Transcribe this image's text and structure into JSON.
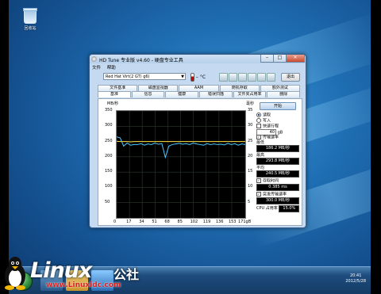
{
  "desktop": {
    "recycle_bin_label": "回收站"
  },
  "window": {
    "title": "HD Tune 专业版 v4.60 - 硬盘专业工具",
    "buttons": {
      "minimize": "–",
      "maximize": "□",
      "close": "✕"
    },
    "menu": [
      "文件",
      "帮助"
    ],
    "toolbar": {
      "drive": "Red Hat Virt(2 GT) g6)",
      "temperature": "– °C",
      "exit_label": "退出"
    },
    "tabs_row1": [
      "文件基准",
      "磁盘监视器",
      "AAM",
      "随机存取",
      "额外测试"
    ],
    "tabs_row2": [
      "基准",
      "信息",
      "健康",
      "错误扫描",
      "文件夹占用率",
      "删除"
    ],
    "active_tab": "基准"
  },
  "benchmark": {
    "unit_left": "MB/秒",
    "unit_right": "毫秒",
    "start_label": "开始",
    "read_label": "读取",
    "write_label": "写入",
    "quick_label": "快速行程",
    "quick_value": "40",
    "quick_unit": "gB",
    "transfer_label": "传输速率",
    "min_label": "最低",
    "min_value": "186.2 MB/秒",
    "max_label": "最高",
    "max_value": "293.8 MB/秒",
    "avg_label": "平均",
    "avg_value": "240.5 MB/秒",
    "access_label": "存取时间",
    "access_value": "0.385 ms",
    "burst_label": "突发传输速率",
    "burst_value": "300.0 MB/秒",
    "cpu_label": "CPU 占用率",
    "cpu_value": "15.0%"
  },
  "chart_data": {
    "type": "line",
    "title": "",
    "xlabel": "",
    "ylabel": "MB/秒",
    "y2label": "毫秒",
    "x": [
      0,
      17,
      34,
      51,
      68,
      85,
      102,
      119,
      136,
      153,
      171
    ],
    "x_tick_labels": [
      "0",
      "17",
      "34",
      "51",
      "68",
      "85",
      "102",
      "119",
      "136",
      "153",
      "171gB"
    ],
    "y_ticks": [
      50,
      100,
      150,
      200,
      250,
      300,
      350
    ],
    "y2_ticks": [
      5,
      10,
      15,
      20,
      25,
      30,
      35
    ],
    "ylim": [
      0,
      350
    ],
    "y2lim": [
      0,
      35
    ],
    "grid": true,
    "series": [
      {
        "values": [
          265,
          262,
          235,
          245,
          238,
          240,
          240,
          243,
          238,
          242,
          240,
          245,
          241,
          243,
          198,
          235,
          240,
          242,
          244,
          241,
          243,
          240,
          245,
          242,
          240,
          238,
          243,
          240,
          242,
          240,
          241,
          239,
          244,
          240,
          243,
          238,
          242,
          240
        ],
        "color": "#4bc8ff"
      },
      {
        "values": [
          25.1,
          25.0,
          25.0,
          25.0,
          24.9,
          25.0,
          25.0,
          25.0,
          25.0,
          25.0,
          25.0,
          25.0,
          25.0,
          25.0,
          25.0,
          25.0,
          25.0,
          25.0,
          25.0,
          25.0,
          25.0,
          25.0,
          25.0,
          25.0,
          25.0,
          25.0,
          25.0,
          25.0,
          25.0,
          25.0,
          25.0,
          25.0,
          25.0,
          25.0,
          25.0,
          25.0,
          25.0,
          25.0
        ],
        "color": "#ffe040"
      }
    ]
  },
  "taskbar": {
    "time": "20:41",
    "date": "2012/5/28"
  },
  "watermark": {
    "brand_a": "Linux",
    "brand_b": "公社",
    "url": "www.Linuxidc.com"
  }
}
